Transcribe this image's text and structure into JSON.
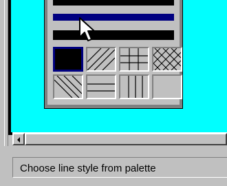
{
  "status_bar": {
    "message": "Choose line style from palette"
  },
  "colors": {
    "canvas_bg": "#00ffff",
    "selected_line": "#000080",
    "line": "#000000",
    "face": "#c0c0c0"
  },
  "palette": {
    "line_styles": [
      "solid-thick",
      "solid-selected",
      "solid-medium"
    ],
    "fill_patterns": [
      "solid-black",
      "diagonal-lines",
      "grid",
      "cross-hatch",
      "reverse-diagonal",
      "horizontal-lines",
      "vertical-lines",
      "empty"
    ]
  },
  "icons": [
    "scroll-left-arrow-icon",
    "mouse-pointer-icon"
  ]
}
